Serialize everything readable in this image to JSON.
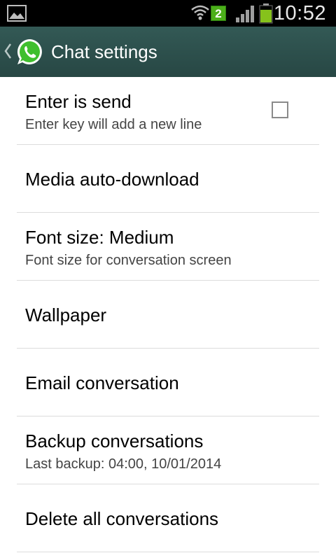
{
  "status_bar": {
    "time": "10:52",
    "sim_badge": "2",
    "icons": [
      "gallery-icon",
      "wifi-icon",
      "sim-icon",
      "signal-icon",
      "battery-icon"
    ],
    "battery_color": "#86c21b"
  },
  "action_bar": {
    "title": "Chat settings",
    "background": "#2c4f4b",
    "icons": [
      "back-chevron-icon",
      "whatsapp-logo-icon"
    ]
  },
  "settings": {
    "items": [
      {
        "title": "Enter is send",
        "subtitle": "Enter key will add a new line",
        "checked": false
      },
      {
        "title": "Media auto-download"
      },
      {
        "title": "Font size: Medium",
        "subtitle": "Font size for conversation screen"
      },
      {
        "title": "Wallpaper"
      },
      {
        "title": "Email conversation"
      },
      {
        "title": "Backup conversations",
        "subtitle": "Last backup: 04:00, 10/01/2014"
      },
      {
        "title": "Delete all conversations"
      }
    ]
  }
}
